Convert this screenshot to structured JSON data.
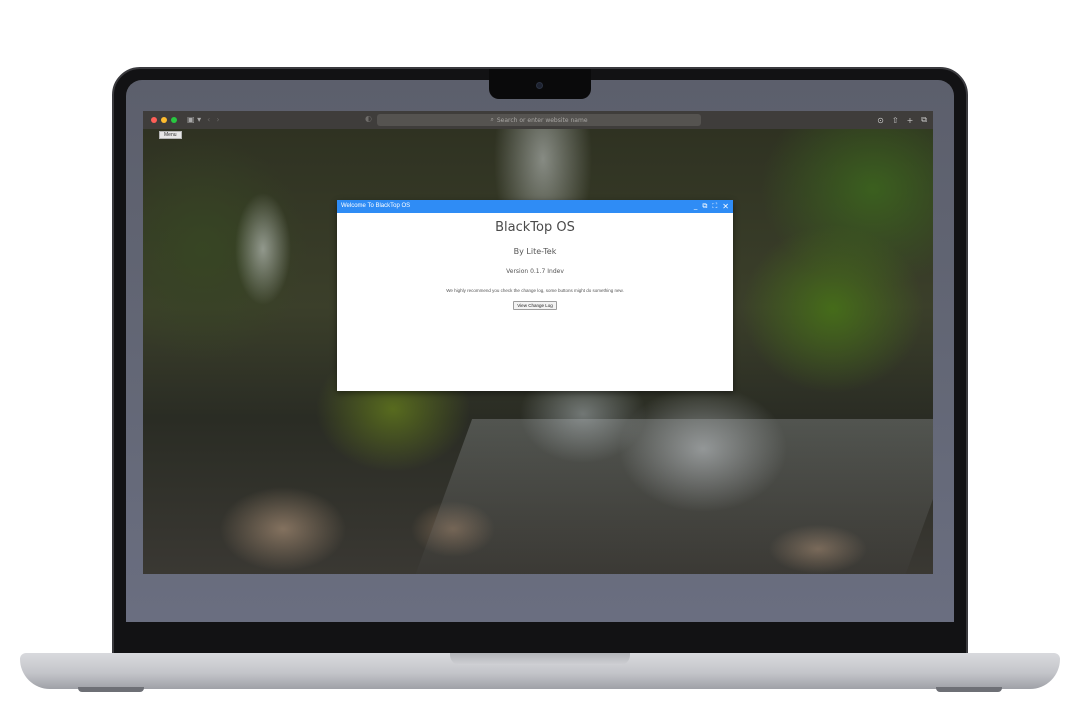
{
  "browser": {
    "address_placeholder": "Search or enter website name",
    "menu_label": "Menu"
  },
  "window": {
    "title": "Welcome To BlackTop OS",
    "controls": {
      "minimize": "_",
      "restore": "⧉",
      "maximize": "⛶",
      "close": "✕"
    },
    "heading": "BlackTop OS",
    "byline": "By Lite-Tek",
    "version": "Version 0.1.7 Indev",
    "note": "We highly recommend you check the change log, some buttons might do something new.",
    "button_label": "View Change Log"
  },
  "colors": {
    "titlebar": "#2f8cf5",
    "window_bg": "#ffffff",
    "browser_toolbar": "#3f3d3b"
  }
}
